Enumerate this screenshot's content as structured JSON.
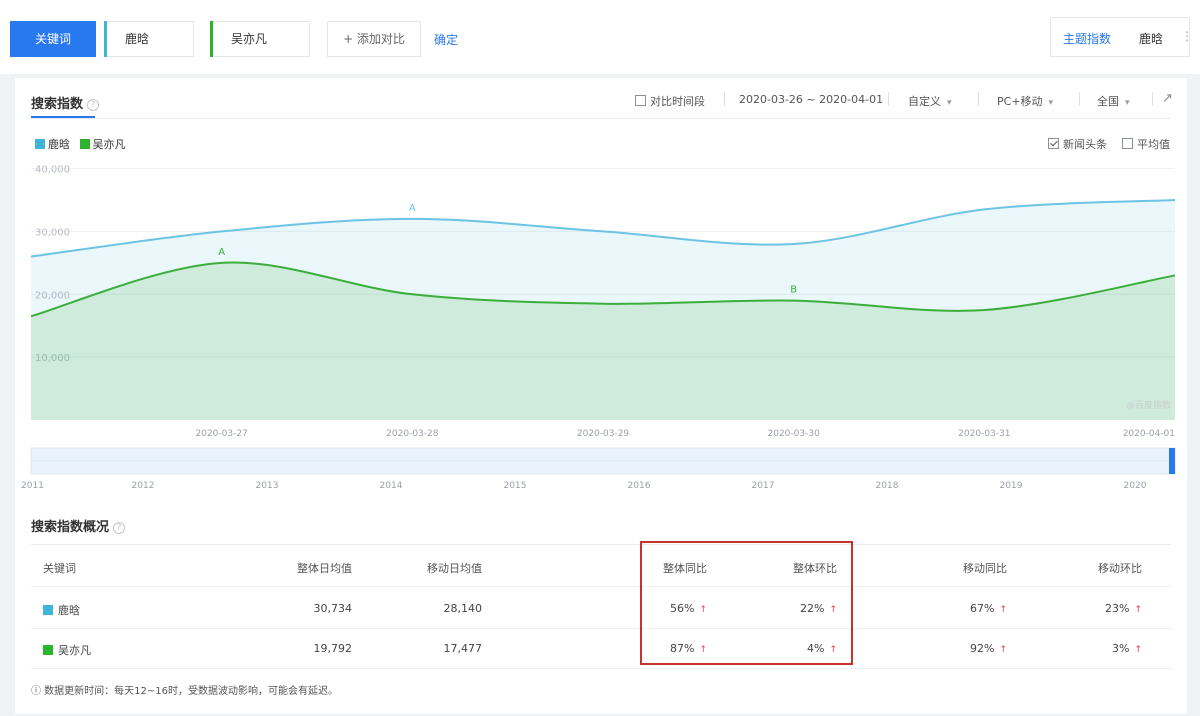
{
  "top": {
    "keyword_button": "关键词",
    "keywords": [
      {
        "label": "鹿晗",
        "color": "#3fb5d9"
      },
      {
        "label": "吴亦凡",
        "color": "#2bb32b"
      }
    ],
    "add_compare": "+ 添加对比",
    "confirm": "确定",
    "right_tab_active": "主题指数",
    "right_tab_other": "鹿晗",
    "more": "⋮"
  },
  "search_index": {
    "title": "搜索指数",
    "info": "?",
    "compare_period": "对比时间段",
    "date_range": "2020-03-26 ~ 2020-04-01",
    "custom": "自定义",
    "device": "PC+移动",
    "region": "全国",
    "caret": "▾",
    "export_icon": "↗",
    "legend": [
      {
        "label": "鹿晗",
        "color": "#3fb5d9"
      },
      {
        "label": "吴亦凡",
        "color": "#2bb32b"
      }
    ],
    "news_headline": "新闻头条",
    "average": "平均值",
    "watermark": "@百度指数"
  },
  "chart_data": {
    "type": "area",
    "x": [
      "2020-03-26",
      "2020-03-27",
      "2020-03-28",
      "2020-03-29",
      "2020-03-30",
      "2020-03-31",
      "2020-04-01"
    ],
    "xticks": [
      "2020-03-27",
      "2020-03-28",
      "2020-03-29",
      "2020-03-30",
      "2020-03-31",
      "2020-04-01"
    ],
    "yticks": [
      "40,000",
      "30,000",
      "20,000",
      "10,000"
    ],
    "ylim": [
      0,
      42000
    ],
    "series": [
      {
        "name": "鹿晗",
        "color": "#6cc3e3",
        "values": [
          26000,
          30000,
          32000,
          30000,
          28000,
          33500,
          35000
        ]
      },
      {
        "name": "吴亦凡",
        "color": "#3cae3c",
        "values": [
          16500,
          25000,
          20000,
          18500,
          19000,
          17500,
          23000
        ]
      }
    ],
    "annotations": [
      {
        "series": 0,
        "index": 2,
        "label": "A"
      },
      {
        "series": 1,
        "index": 1,
        "label": "A"
      },
      {
        "series": 1,
        "index": 4,
        "label": "B"
      }
    ],
    "timeline_years": [
      "2011",
      "2012",
      "2013",
      "2014",
      "2015",
      "2016",
      "2017",
      "2018",
      "2019",
      "2020"
    ],
    "grid": true
  },
  "overview": {
    "title": "搜索指数概况",
    "headers": [
      "关键词",
      "整体日均值",
      "移动日均值",
      "整体同比",
      "整体环比",
      "移动同比",
      "移动环比"
    ],
    "rows": [
      {
        "keyword": "鹿晗",
        "color": "#3fb5d9",
        "overall_avg": "30,734",
        "mobile_avg": "28,140",
        "overall_yoy": "56%",
        "overall_mom": "22%",
        "mobile_yoy": "67%",
        "mobile_mom": "23%"
      },
      {
        "keyword": "吴亦凡",
        "color": "#2bb32b",
        "overall_avg": "19,792",
        "mobile_avg": "17,477",
        "overall_yoy": "87%",
        "overall_mom": "4%",
        "mobile_yoy": "92%",
        "mobile_mom": "3%"
      }
    ],
    "arrow": "↑",
    "footnote": "ⓘ 数据更新时间：每天12~16时，受数据波动影响，可能会有延迟。"
  }
}
